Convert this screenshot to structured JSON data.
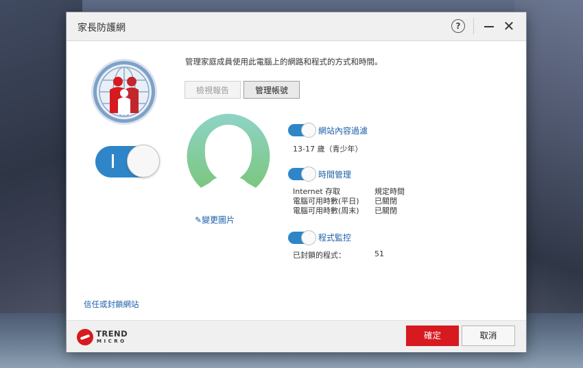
{
  "window": {
    "title": "家長防護網"
  },
  "header": {
    "intro": "管理家庭成員使用此電腦上的網路和程式的方式和時間。"
  },
  "buttons": {
    "view_report": "檢視報告",
    "manage_account": "管理帳號",
    "ok": "確定",
    "cancel": "取消"
  },
  "profile": {
    "change_picture": "變更圖片"
  },
  "features": {
    "web_filter": {
      "label": "網站內容過濾",
      "value": "13-17 歲（青少年）",
      "enabled": true
    },
    "time_limits": {
      "label": "時間管理",
      "rows": [
        {
          "name": "Internet 存取",
          "value": "規定時間"
        },
        {
          "name": "電腦可用時數(平日)",
          "value": "已關閉"
        },
        {
          "name": "電腦可用時數(周末)",
          "value": "已關閉"
        }
      ],
      "enabled": true
    },
    "program_control": {
      "label": "程式監控",
      "blocked_label": "已封鎖的程式：",
      "blocked_count": "51",
      "enabled": true
    }
  },
  "links": {
    "trust_block": "信任或封鎖網站"
  },
  "brand": {
    "line1": "TREND",
    "line2": "MICRO"
  },
  "colors": {
    "accent": "#2e86c9",
    "link": "#1c5fa8",
    "brand_red": "#d71920"
  }
}
